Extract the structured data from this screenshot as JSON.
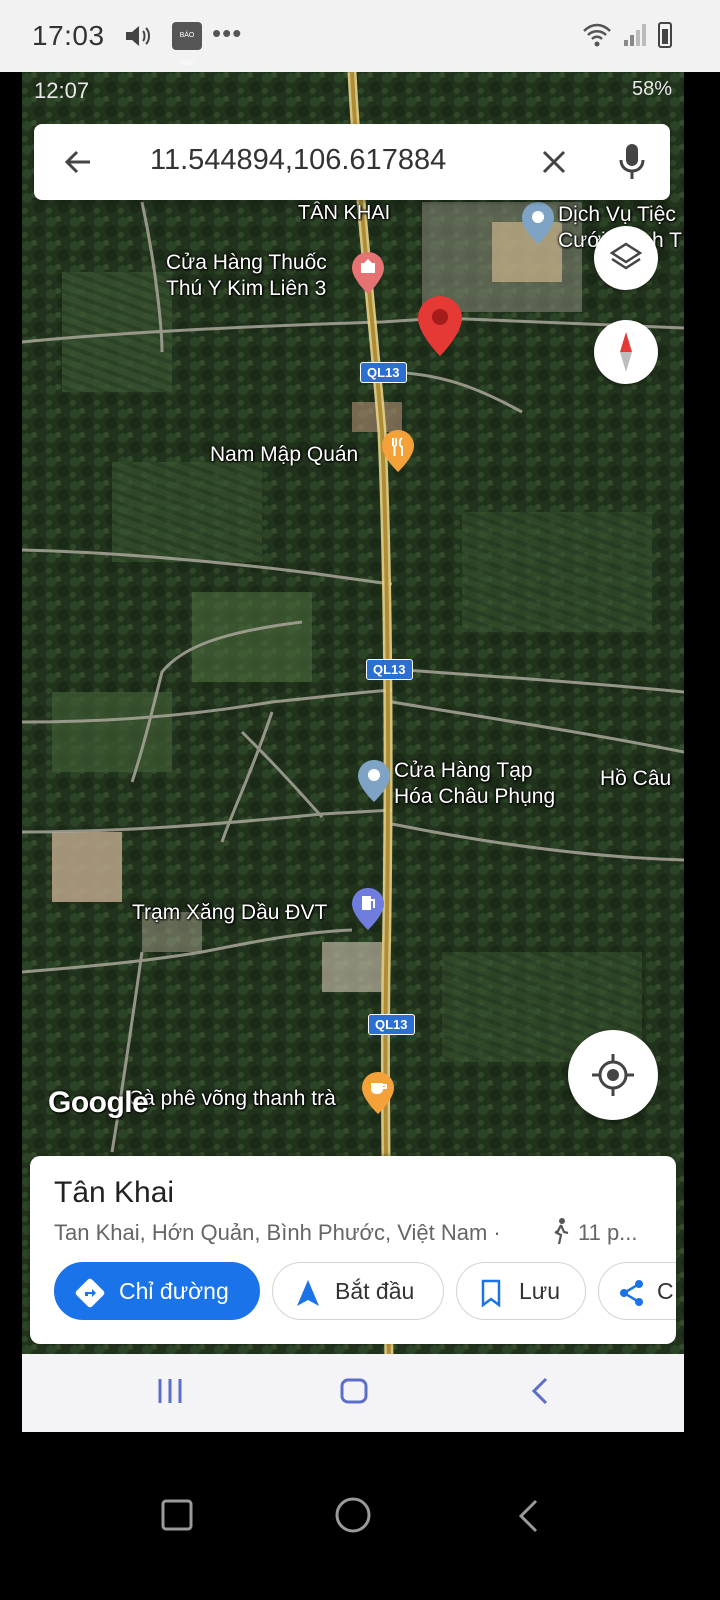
{
  "outer_status": {
    "time": "17:03",
    "app_badge": "BÁO HAY"
  },
  "inner_status": {
    "time": "12:07",
    "battery": "58%"
  },
  "search": {
    "query": "11.544894,106.617884"
  },
  "map": {
    "labels": {
      "area": "TÂN KHAI",
      "pharmacy": "Cửa Hàng Thuốc\nThú Y Kim Liên 3",
      "service": "Dịch Vụ Tiệc\nCưới Thịnh T",
      "restaurant": "Nam Mập Quán",
      "grocery": "Cửa Hàng Tạp\nHóa Châu Phụng",
      "pond": "Hồ Câu",
      "gas": "Trạm Xăng Dầu ĐVT",
      "cafe": "Cà phê võng thanh trà"
    },
    "road_badges": [
      "QL13",
      "QL13",
      "QL13"
    ],
    "attribution": "Google"
  },
  "place_card": {
    "title": "Tân Khai",
    "address": "Tan Khai, Hớn Quản, Bình Phước, Việt Nam ·",
    "walk_time": "11 p...",
    "actions": {
      "directions": "Chỉ đường",
      "start": "Bắt đầu",
      "save": "Lưu",
      "share": "C"
    }
  },
  "colors": {
    "accent": "#1a73e8",
    "pin": "#e53935",
    "road": "#c8a24a"
  }
}
